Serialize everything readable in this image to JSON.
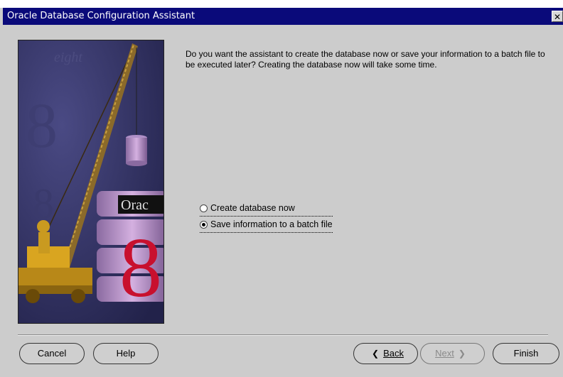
{
  "window": {
    "title": "Oracle Database Configuration Assistant",
    "close_label": "✕"
  },
  "image": {
    "logo_text": "Orac",
    "numeral": "8",
    "bg_word": "eight"
  },
  "content": {
    "intro": "Do you want the assistant to create the database now or save your information to a batch file to be executed later?  Creating the database now will take some time."
  },
  "options": [
    {
      "label": "Create database now",
      "selected": false
    },
    {
      "label": "Save information to a batch file",
      "selected": true
    }
  ],
  "buttons": {
    "cancel": "Cancel",
    "help": "Help",
    "back": "Back",
    "next": "Next",
    "finish": "Finish"
  },
  "colors": {
    "titlebar": "#0a0a7a",
    "dialog_bg": "#cccccc",
    "image_bg": "#2e2e5e",
    "crane": "#d9a520",
    "barrel": "#b48bc8",
    "numeral": "#c8102e"
  }
}
